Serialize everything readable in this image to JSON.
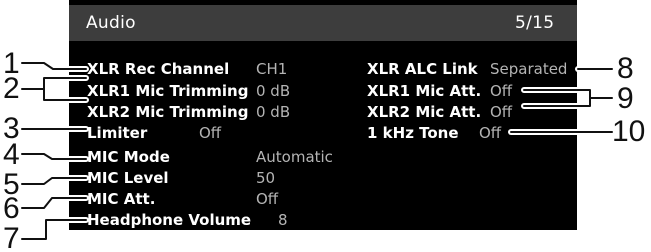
{
  "header": {
    "title": "Audio",
    "page": "5/15"
  },
  "settings": {
    "xlr_rec_channel": {
      "label": "XLR Rec Channel",
      "value": "CH1"
    },
    "xlr1_mic_trimming": {
      "label": "XLR1 Mic Trimming",
      "value": "0 dB"
    },
    "xlr2_mic_trimming": {
      "label": "XLR2 Mic Trimming",
      "value": "0 dB"
    },
    "limiter": {
      "label": "Limiter",
      "value": "Off"
    },
    "mic_mode": {
      "label": "MIC Mode",
      "value": "Automatic"
    },
    "mic_level": {
      "label": "MIC Level",
      "value": "50"
    },
    "mic_att": {
      "label": "MIC Att.",
      "value": "Off"
    },
    "headphone_volume": {
      "label": "Headphone Volume",
      "value": "8"
    },
    "xlr_alc_link": {
      "label": "XLR ALC Link",
      "value": "Separated"
    },
    "xlr1_mic_att": {
      "label": "XLR1 Mic Att.",
      "value": "Off"
    },
    "xlr2_mic_att": {
      "label": "XLR2 Mic Att.",
      "value": "Off"
    },
    "khz_tone": {
      "label": "1 kHz Tone",
      "value": "Off"
    }
  },
  "callouts": [
    "1",
    "2",
    "3",
    "4",
    "5",
    "6",
    "7",
    "8",
    "9",
    "10"
  ]
}
